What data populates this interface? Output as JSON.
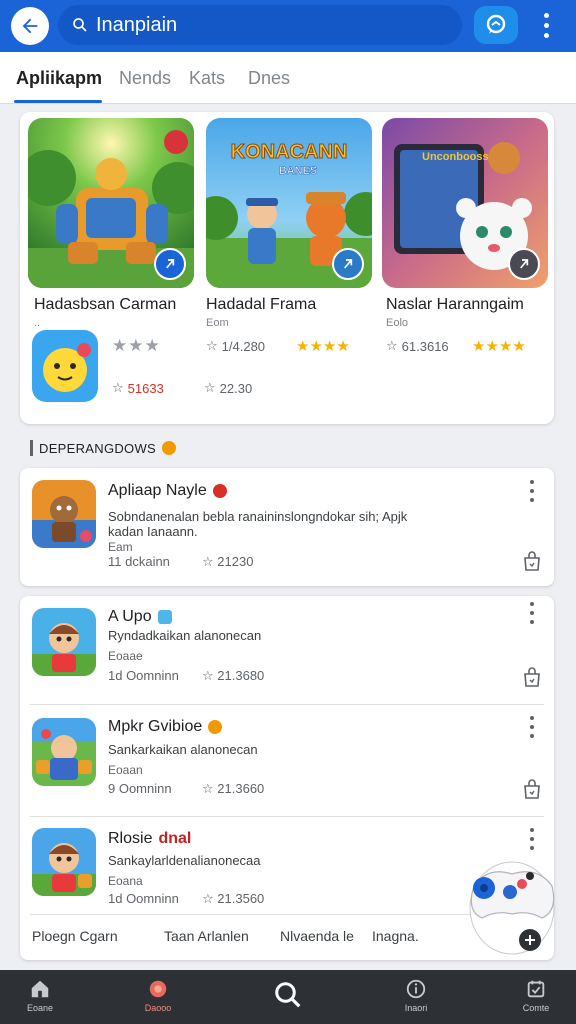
{
  "search": {
    "query": "Inanpiain",
    "back_icon": "arrow-left-icon",
    "search_icon": "search-icon",
    "chat_icon": "chat-icon"
  },
  "tabs": [
    {
      "label": "Apliikapm",
      "active": true
    },
    {
      "label": "Nends",
      "active": false
    },
    {
      "label": "Kats",
      "active": false
    },
    {
      "label": "Dnes",
      "active": false
    }
  ],
  "featured": [
    {
      "art_title": "",
      "title": "Hadasbsan Carman",
      "subtitle": "..",
      "rating_text": "",
      "stars": "★★★",
      "install_count": "51633"
    },
    {
      "art_title": "KONACANN",
      "art_subtitle": "BANES",
      "title": "Hadadal Frama",
      "subtitle": "Eom",
      "rating_text": "1/4.280",
      "stars": "★★★★",
      "install_count": "22.30"
    },
    {
      "art_title": "Unconbooss",
      "title": "Naslar Haranngaim",
      "subtitle": "Eolo",
      "rating_text": "61.3616",
      "stars": "★★★★"
    }
  ],
  "section": {
    "title": "DEPERANGDOWS"
  },
  "list": [
    {
      "name": "Apliaap Nayle",
      "badge_color": "#d93025",
      "description": "Sobndanenalan bebla ranaininslongndokar sih; Apjk kadan Ianaann.",
      "small": "Eam",
      "meta": "11 dckainn",
      "rating": "21230"
    },
    {
      "name": "A Upo",
      "badge_color": "#4fb6e8",
      "description": "Ryndadkaikan alanonecan",
      "small": "Eoaae",
      "meta": "1d Oomninn",
      "rating": "21.3680"
    },
    {
      "name": "Mpkr Gvibioe",
      "badge_color": "#f29900",
      "description": "Sankarkaikan alanonecan",
      "small": "Eoaan",
      "meta": "9 Oomninn",
      "rating": "21.3660"
    },
    {
      "name": "Rlosie",
      "name_red": "dnal",
      "description": "Sankaylarldenalianonecaa",
      "small": "Eoana",
      "meta": "1d Oomninn",
      "rating": "21.3560"
    }
  ],
  "filters": [
    "Ploegn Cgarn",
    "Taan Arlanlen",
    "Nlvaenda le",
    "Inagna."
  ],
  "bottom_nav": [
    {
      "label": "Eoane",
      "icon": "home-icon"
    },
    {
      "label": "Daooo",
      "icon": "games-icon",
      "active": true
    },
    {
      "label": "",
      "icon": "search-icon"
    },
    {
      "label": "Inaori",
      "icon": "info-icon"
    },
    {
      "label": "Comte",
      "icon": "library-icon"
    }
  ],
  "colors": {
    "primary": "#1a64d8",
    "star_gold": "#f4b400",
    "nav_bg": "#2d3136"
  }
}
